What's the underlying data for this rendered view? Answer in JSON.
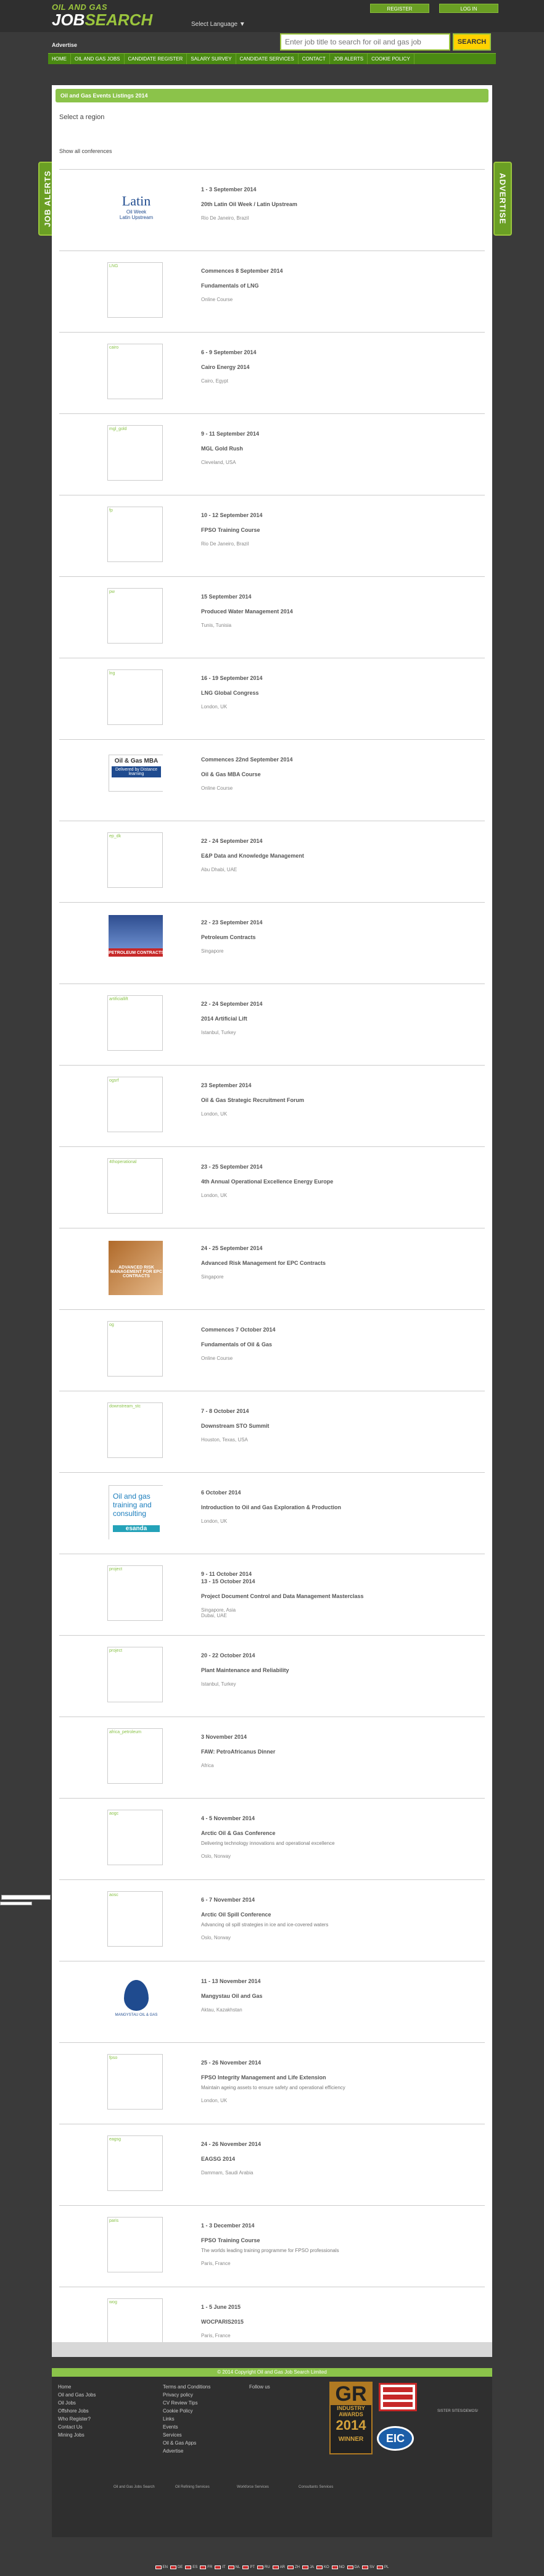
{
  "header": {
    "logo_line1": "OIL AND GAS",
    "logo_line2a": "JOB",
    "logo_line2b": "SEARCH",
    "language": "Select Language ▼",
    "register": "REGISTER",
    "login": "LOG IN",
    "search_placeholder": "Enter job title to search for oil and gas job",
    "search_button": "SEARCH",
    "advertise": "Advertise"
  },
  "nav": [
    "HOME",
    "OIL AND GAS JOBS",
    "CANDIDATE REGISTER",
    "SALARY SURVEY",
    "CANDIDATE SERVICES",
    "CONTACT",
    "JOB ALERTS",
    "COOKIE POLICY"
  ],
  "side_tabs": {
    "left": "JOB ALERTS",
    "right": "ADVERTISE"
  },
  "main": {
    "heading": "Oil and Gas Events Listings 2014",
    "select_region": "Select a region",
    "show_all": "Show all conferences"
  },
  "events": [
    {
      "thumb": "latin",
      "thumb_label": "",
      "date": "1 - 3 September 2014",
      "title": "20th Latin Oil Week / Latin Upstream",
      "sub": "",
      "loc": "Rio De Janeiro, Brazil"
    },
    {
      "thumb": "empty",
      "thumb_label": "LNG",
      "date": "Commences 8 September 2014",
      "title": "Fundamentals of LNG",
      "sub": "",
      "loc": "Online Course"
    },
    {
      "thumb": "empty",
      "thumb_label": "cairo",
      "date": "6 - 9 September 2014",
      "title": "Cairo Energy 2014",
      "sub": "",
      "loc": "Cairo, Egypt"
    },
    {
      "thumb": "empty",
      "thumb_label": "mgl_gold",
      "date": "9 - 11 September 2014",
      "title": "MGL Gold Rush",
      "sub": "",
      "loc": "Cleveland, USA"
    },
    {
      "thumb": "empty",
      "thumb_label": "fp",
      "date": "10 - 12 September 2014",
      "title": "FPSO Training Course",
      "sub": "",
      "loc": "Rio De Janeiro, Brazil"
    },
    {
      "thumb": "empty",
      "thumb_label": "pw",
      "date": "15 September 2014",
      "title": "Produced Water Management 2014",
      "sub": "",
      "loc": "Tunis, Tunisia"
    },
    {
      "thumb": "empty",
      "thumb_label": "lng",
      "date": "16 - 19 September 2014",
      "title": "LNG Global Congress",
      "sub": "",
      "loc": "London, UK"
    },
    {
      "thumb": "mba",
      "thumb_label": "",
      "date": "Commences 22nd September 2014",
      "title": "Oil & Gas MBA Course",
      "sub": "",
      "loc": "Online Course"
    },
    {
      "thumb": "empty",
      "thumb_label": "ep_dk",
      "date": "22 - 24 September 2014",
      "title": "E&P Data and Knowledge Management",
      "sub": "",
      "loc": "Abu Dhabi, UAE"
    },
    {
      "thumb": "petro",
      "thumb_label": "",
      "date": "22 - 23 September 2014",
      "title": "Petroleum Contracts",
      "sub": "",
      "loc": "Singapore"
    },
    {
      "thumb": "empty",
      "thumb_label": "artificiallift",
      "date": "22 - 24 September 2014",
      "title": "2014 Artificial Lift",
      "sub": "",
      "loc": "Istanbul, Turkey"
    },
    {
      "thumb": "empty",
      "thumb_label": "ogsrf",
      "date": "23 September 2014",
      "title": "Oil & Gas Strategic Recruitment Forum",
      "sub": "",
      "loc": "London, UK"
    },
    {
      "thumb": "empty",
      "thumb_label": "4thoperational",
      "date": "23 - 25 September 2014",
      "title": "4th Annual Operational Excellence Energy Europe",
      "sub": "",
      "loc": "London, UK"
    },
    {
      "thumb": "risk",
      "thumb_label": "",
      "date": "24 - 25 September 2014",
      "title": "Advanced Risk Management for EPC Contracts",
      "sub": "",
      "loc": "Singapore"
    },
    {
      "thumb": "empty",
      "thumb_label": "og",
      "date": "Commences 7 October 2014",
      "title": "Fundamentals of Oil & Gas",
      "sub": "",
      "loc": "Online Course"
    },
    {
      "thumb": "empty",
      "thumb_label": "downstream_stc",
      "date": "7 - 8 October 2014",
      "title": "Downstream STO Summit",
      "sub": "",
      "loc": "Houston, Texas, USA"
    },
    {
      "thumb": "esanda",
      "thumb_label": "",
      "date": "6 October 2014",
      "title": "Introduction to Oil and Gas Exploration & Production",
      "sub": "",
      "loc": "London, UK"
    },
    {
      "thumb": "empty",
      "thumb_label": "project",
      "date": "9 - 11 October 2014",
      "date2": "13 - 15 October 2014",
      "title": "Project Document Control and Data Management Masterclass",
      "sub": "",
      "loc": "Singapore, Asia",
      "loc2": "Dubai, UAE"
    },
    {
      "thumb": "empty",
      "thumb_label": "project",
      "date": "20 - 22 October 2014",
      "title": "Plant Maintenance and Reliability",
      "sub": "",
      "loc": "Istanbul, Turkey"
    },
    {
      "thumb": "empty",
      "thumb_label": "africa_petroleum",
      "date": "3 November 2014",
      "title": "FAW: PetroAfricanus Dinner",
      "sub": "",
      "loc": "Africa"
    },
    {
      "thumb": "empty",
      "thumb_label": "aogc",
      "date": "4 - 5 November 2014",
      "title": "Arctic Oil & Gas Conference",
      "sub": "Delivering technology innovations and operational excellence",
      "loc": "Oslo, Norway"
    },
    {
      "thumb": "empty",
      "thumb_label": "aosc",
      "date": "6 - 7 November 2014",
      "title": "Arctic Oil Spill Conference",
      "sub": "Advancing oil spill strategies in ice and ice-covered waters",
      "loc": "Oslo, Norway"
    },
    {
      "thumb": "mangy",
      "thumb_label": "",
      "date": "11 - 13 November 2014",
      "title": "Mangystau Oil and Gas",
      "sub": "",
      "loc": "Aktau, Kazakhstan"
    },
    {
      "thumb": "empty",
      "thumb_label": "fpso",
      "date": "25 - 26 November 2014",
      "title": "FPSO Integrity Management and Life Extension",
      "sub": "Maintain ageing assets to ensure safety and operational efficiency",
      "loc": "London, UK"
    },
    {
      "thumb": "empty",
      "thumb_label": "eagsg",
      "date": "24 - 26 November 2014",
      "title": "EAGSG 2014",
      "sub": "",
      "loc": "Dammam, Saudi Arabia"
    },
    {
      "thumb": "empty",
      "thumb_label": "paris",
      "date": "1 - 3 December 2014",
      "title": "FPSO Training Course",
      "sub": "The worlds leading training programme for FPSO professionals",
      "loc": "Paris, France"
    },
    {
      "thumb": "empty",
      "thumb_label": "wog",
      "date": "1 - 5 June 2015",
      "title": "WOCPARIS2015",
      "sub": "",
      "loc": "Paris, France"
    }
  ],
  "footer": {
    "copyright": "© 2014 Copyright Oil and Gas Job Search Limited",
    "col1": [
      "Home",
      "Oil and Gas Jobs",
      "Oil Jobs",
      "Offshore Jobs",
      "Who Register?",
      "Contact Us",
      "Mining Jobs"
    ],
    "col2": [
      "Terms and Conditions",
      "Privacy policy",
      "CV Review Tips",
      "Cookie Policy",
      "Links",
      "Events",
      "Services",
      "Oil & Gas Apps",
      "Advertise"
    ],
    "follow": "Follow us",
    "awards_gr": "GR",
    "awards_title": "INDUSTRY AWARDS",
    "awards_year": "2014",
    "awards_winner": "WINNER",
    "eic": "EIC",
    "sister": "SISTER SITES/DEMOS/",
    "links_row": [
      "Oil and Gas Jobs Search",
      "Oil Refining Services",
      "Workforce Services",
      "Consultants Services"
    ],
    "flags": [
      "EN",
      "DE",
      "ES",
      "FR",
      "IT",
      "NL",
      "PT",
      "RU",
      "AR",
      "ZH",
      "JA",
      "KO",
      "NO",
      "DA",
      "SV",
      "PL"
    ]
  }
}
